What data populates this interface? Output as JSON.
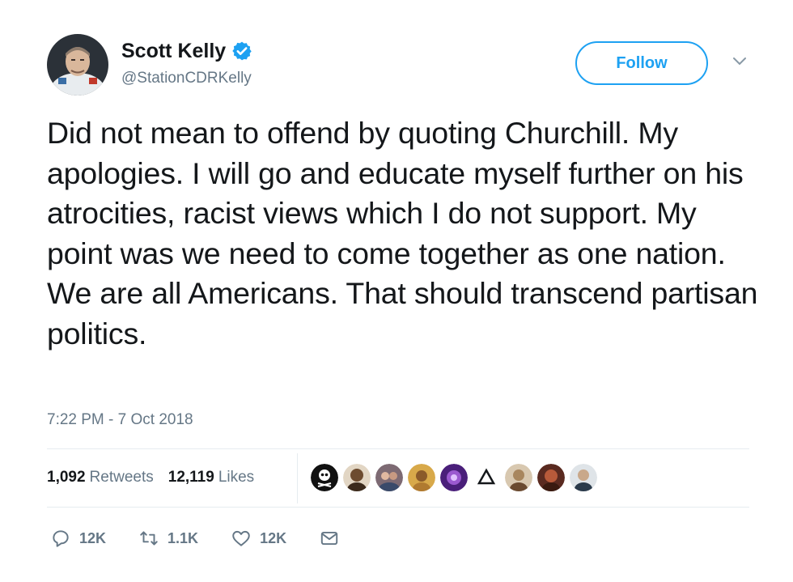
{
  "author": {
    "name": "Scott Kelly",
    "handle": "@StationCDRKelly",
    "verified": true,
    "avatar_icon": "astronaut-avatar"
  },
  "follow_label": "Follow",
  "tweet": {
    "text": "Did not mean to offend by quoting Churchill. My apologies. I will go and educate myself further on his atrocities, racist views which I do not support. My point was we need to come together as one nation. We are all Americans. That should transcend partisan politics.",
    "timestamp": "7:22 PM - 7 Oct 2018"
  },
  "stats": {
    "retweets_count": "1,092",
    "retweets_label": "Retweets",
    "likes_count": "12,119",
    "likes_label": "Likes"
  },
  "likers": [
    {
      "icon": "skull-avatar",
      "color": "#111111"
    },
    {
      "icon": "person-avatar",
      "color": "#8a6a4a"
    },
    {
      "icon": "group-avatar",
      "color": "#6b5a66"
    },
    {
      "icon": "person-avatar",
      "color": "#c49a3a"
    },
    {
      "icon": "purple-avatar",
      "color": "#5a2a8a"
    },
    {
      "icon": "triangle-avatar",
      "color": "#ffffff"
    },
    {
      "icon": "person-avatar",
      "color": "#a8865e"
    },
    {
      "icon": "person-avatar",
      "color": "#8a3a2a"
    },
    {
      "icon": "person-avatar",
      "color": "#b0b8c0"
    }
  ],
  "actions": {
    "reply_count": "12K",
    "retweet_count": "1.1K",
    "like_count": "12K"
  },
  "colors": {
    "accent": "#1da1f2",
    "text": "#14171a",
    "secondary": "#657786",
    "divider": "#e6ecf0"
  }
}
